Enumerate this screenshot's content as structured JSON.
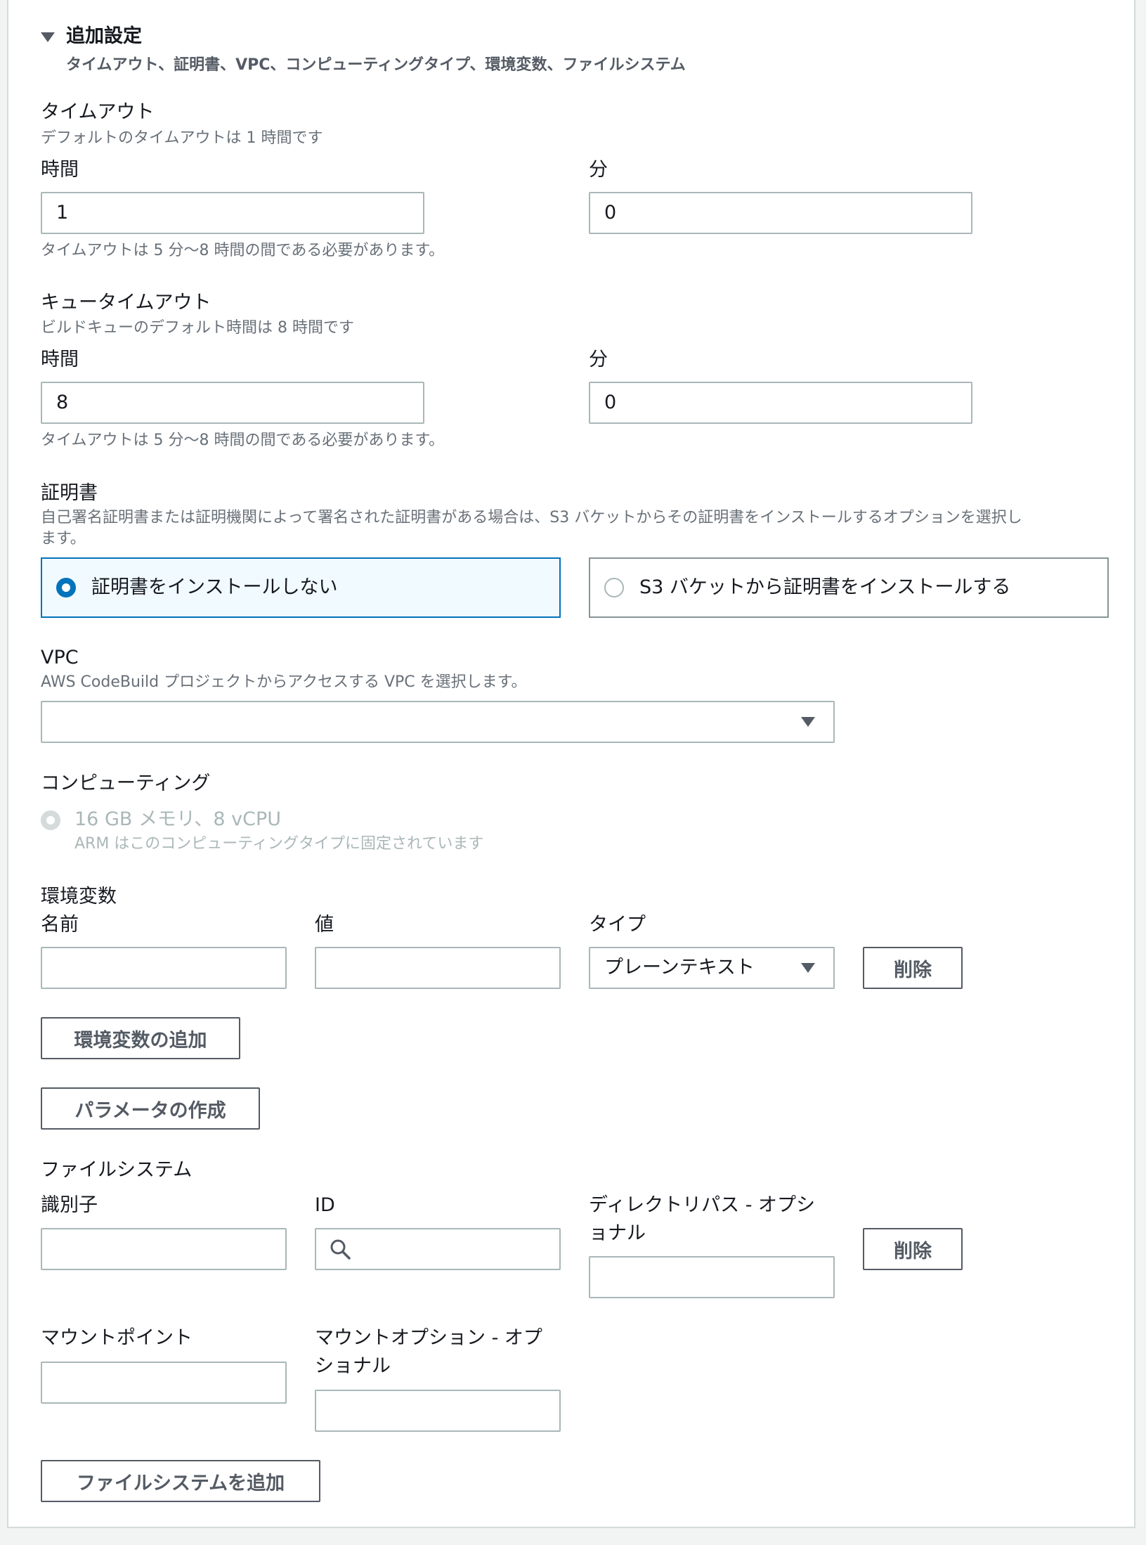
{
  "section": {
    "title": "追加設定",
    "subtitle": "タイムアウト、証明書、VPC、コンピューティングタイプ、環境変数、ファイルシステム"
  },
  "timeout": {
    "label": "タイムアウト",
    "description": "デフォルトのタイムアウトは 1 時間です",
    "hours_label": "時間",
    "hours_value": "1",
    "minutes_label": "分",
    "minutes_value": "0",
    "constraint": "タイムアウトは 5 分〜8 時間の間である必要があります。"
  },
  "queue_timeout": {
    "label": "キュータイムアウト",
    "description": "ビルドキューのデフォルト時間は 8 時間です",
    "hours_label": "時間",
    "hours_value": "8",
    "minutes_label": "分",
    "minutes_value": "0",
    "constraint": "タイムアウトは 5 分〜8 時間の間である必要があります。"
  },
  "certificate": {
    "label": "証明書",
    "description_line1": "自己署名証明書または証明機関によって署名された証明書がある場合は、S3 バケットからその証明書をインストールするオプションを選択し",
    "description_line2": "ます。",
    "option_none": "証明書をインストールしない",
    "option_s3": "S3 バケットから証明書をインストールする",
    "selected": "option_none"
  },
  "vpc": {
    "label": "VPC",
    "description": "AWS CodeBuild プロジェクトからアクセスする VPC を選択します。",
    "selected_value": ""
  },
  "compute": {
    "label": "コンピューティング",
    "option": "16 GB メモリ、8 vCPU",
    "note": "ARM はこのコンピューティングタイプに固定されています"
  },
  "env_vars": {
    "label": "環境変数",
    "name_label": "名前",
    "value_label": "値",
    "type_label": "タイプ",
    "type_value": "プレーンテキスト",
    "remove_button": "削除",
    "add_button": "環境変数の追加",
    "create_param_button": "パラメータの作成"
  },
  "file_system": {
    "label": "ファイルシステム",
    "identifier_label": "識別子",
    "id_label": "ID",
    "dir_path_label_line1": "ディレクトリパス - オプシ",
    "dir_path_label_line2": "ョナル",
    "remove_button": "削除",
    "mount_point_label": "マウントポイント",
    "mount_options_label_line1": "マウントオプション - オプ",
    "mount_options_label_line2": "ショナル",
    "add_button": "ファイルシステムを追加"
  },
  "colors": {
    "accent": "#0073bb",
    "border": "#aab7b8",
    "muted_text": "#687078",
    "button_text": "#545b64"
  }
}
